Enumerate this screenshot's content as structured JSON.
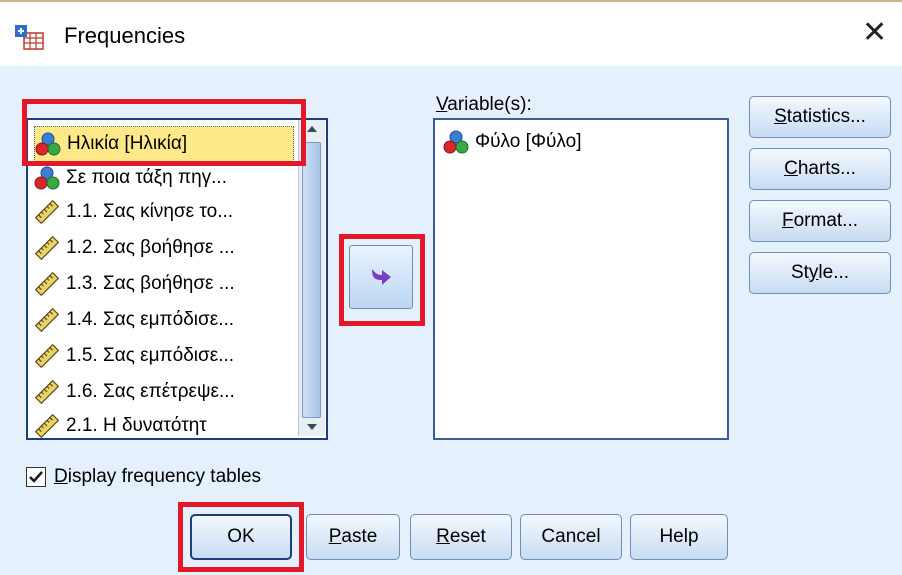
{
  "window": {
    "title": "Frequencies",
    "close_glyph": "✕",
    "icon": "spss-table-icon"
  },
  "source_list": {
    "items": [
      {
        "label": "Ηλικία [Ηλικία]",
        "icon": "nominal-variable-icon",
        "selected": true
      },
      {
        "label": "Σε ποια τάξη πηγ...",
        "icon": "nominal-variable-icon",
        "selected": false
      },
      {
        "label": "1.1. Σας κίνησε το...",
        "icon": "scale-ruler-icon",
        "selected": false
      },
      {
        "label": "1.2. Σας βοήθησε ...",
        "icon": "scale-ruler-icon",
        "selected": false
      },
      {
        "label": "1.3. Σας βοήθησε ...",
        "icon": "scale-ruler-icon",
        "selected": false
      },
      {
        "label": "1.4. Σας εμπόδισε...",
        "icon": "scale-ruler-icon",
        "selected": false
      },
      {
        "label": "1.5. Σας εμπόδισε...",
        "icon": "scale-ruler-icon",
        "selected": false
      },
      {
        "label": "1.6. Σας επέτρεψε...",
        "icon": "scale-ruler-icon",
        "selected": false
      },
      {
        "label": "2.1. Η δυνατότητ",
        "icon": "scale-ruler-icon",
        "selected": false
      }
    ]
  },
  "variables": {
    "label_underlined": "V",
    "label_rest": "ariable(s):",
    "items": [
      {
        "label": "Φύλο [Φύλο]",
        "icon": "nominal-variable-icon"
      }
    ]
  },
  "side_buttons": {
    "statistics": {
      "u": "S",
      "rest": "tatistics..."
    },
    "charts": {
      "u": "C",
      "rest": "harts..."
    },
    "format": {
      "u": "F",
      "rest": "ormat..."
    },
    "style": {
      "pre": "St",
      "u": "y",
      "rest": "le..."
    }
  },
  "checkbox": {
    "u": "D",
    "rest": "isplay frequency tables",
    "checked": true
  },
  "bottom_buttons": {
    "ok": "OK",
    "paste": {
      "u": "P",
      "rest": "aste"
    },
    "reset": {
      "u": "R",
      "rest": "eset"
    },
    "cancel": "Cancel",
    "help": "Help"
  },
  "colors": {
    "highlight_red": "#e3192a",
    "selection_yellow": "#fde98a",
    "dialog_bg": "#e4f0fb",
    "arrow_purple": "#7a3ec4"
  }
}
